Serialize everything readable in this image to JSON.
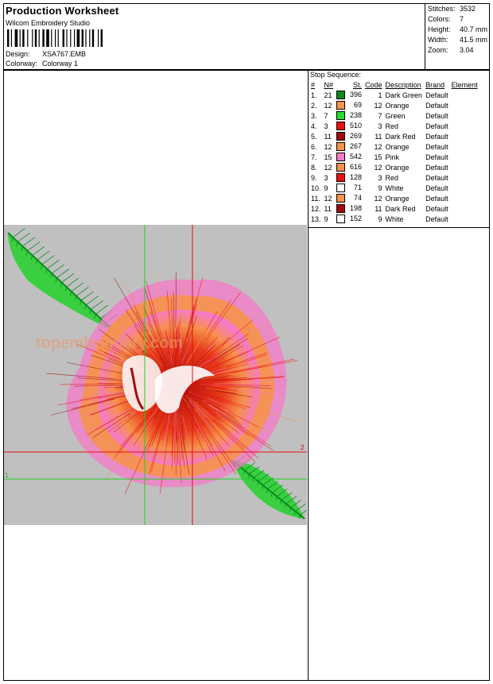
{
  "header": {
    "title": "Production Worksheet",
    "studio": "Wilcom Embroidery Studio",
    "design_label": "Design:",
    "design_value": "XSA767.EMB",
    "colorway_label": "Colorway:",
    "colorway_value": "Colorway 1"
  },
  "stats": {
    "stitches_label": "Stitches:",
    "stitches_value": "3532",
    "colors_label": "Colors:",
    "colors_value": "7",
    "height_label": "Height:",
    "height_value": "40.7 mm",
    "width_label": "Width:",
    "width_value": "41.5 mm",
    "zoom_label": "Zoom:",
    "zoom_value": "3.04"
  },
  "stop_sequence": {
    "title": "Stop Sequence:",
    "headers": [
      "#",
      "N#",
      "St.",
      "Code",
      "Description",
      "Brand",
      "Element"
    ],
    "rows": [
      {
        "idx": "1.",
        "n": "21",
        "st": "396",
        "code": "1",
        "desc": "Dark Green",
        "brand": "Default",
        "color": "#0a8a1e"
      },
      {
        "idx": "2.",
        "n": "12",
        "st": "69",
        "code": "12",
        "desc": "Orange",
        "brand": "Default",
        "color": "#f6924a"
      },
      {
        "idx": "3.",
        "n": "7",
        "st": "238",
        "code": "7",
        "desc": "Green",
        "brand": "Default",
        "color": "#22e02a"
      },
      {
        "idx": "4.",
        "n": "3",
        "st": "510",
        "code": "3",
        "desc": "Red",
        "brand": "Default",
        "color": "#e81010"
      },
      {
        "idx": "5.",
        "n": "11",
        "st": "269",
        "code": "11",
        "desc": "Dark Red",
        "brand": "Default",
        "color": "#a00c0c"
      },
      {
        "idx": "6.",
        "n": "12",
        "st": "267",
        "code": "12",
        "desc": "Orange",
        "brand": "Default",
        "color": "#f6924a"
      },
      {
        "idx": "7.",
        "n": "15",
        "st": "542",
        "code": "15",
        "desc": "Pink",
        "brand": "Default",
        "color": "#f57ac8"
      },
      {
        "idx": "8.",
        "n": "12",
        "st": "616",
        "code": "12",
        "desc": "Orange",
        "brand": "Default",
        "color": "#f6924a"
      },
      {
        "idx": "9.",
        "n": "3",
        "st": "128",
        "code": "3",
        "desc": "Red",
        "brand": "Default",
        "color": "#e81010"
      },
      {
        "idx": "10.",
        "n": "9",
        "st": "71",
        "code": "9",
        "desc": "White",
        "brand": "Default",
        "color": "#ffffff"
      },
      {
        "idx": "11.",
        "n": "12",
        "st": "74",
        "code": "12",
        "desc": "Orange",
        "brand": "Default",
        "color": "#f6924a"
      },
      {
        "idx": "12.",
        "n": "11",
        "st": "198",
        "code": "11",
        "desc": "Dark Red",
        "brand": "Default",
        "color": "#a00c0c"
      },
      {
        "idx": "13.",
        "n": "9",
        "st": "152",
        "code": "9",
        "desc": "White",
        "brand": "Default",
        "color": "#ffffff"
      }
    ]
  },
  "design_area": {
    "watermark": "topembroidery.com",
    "guide_label_1": "1",
    "guide_label_2": "2",
    "guide_color_green": "#22cc22",
    "guide_color_red": "#e01010",
    "background": "#c0c0c0"
  }
}
